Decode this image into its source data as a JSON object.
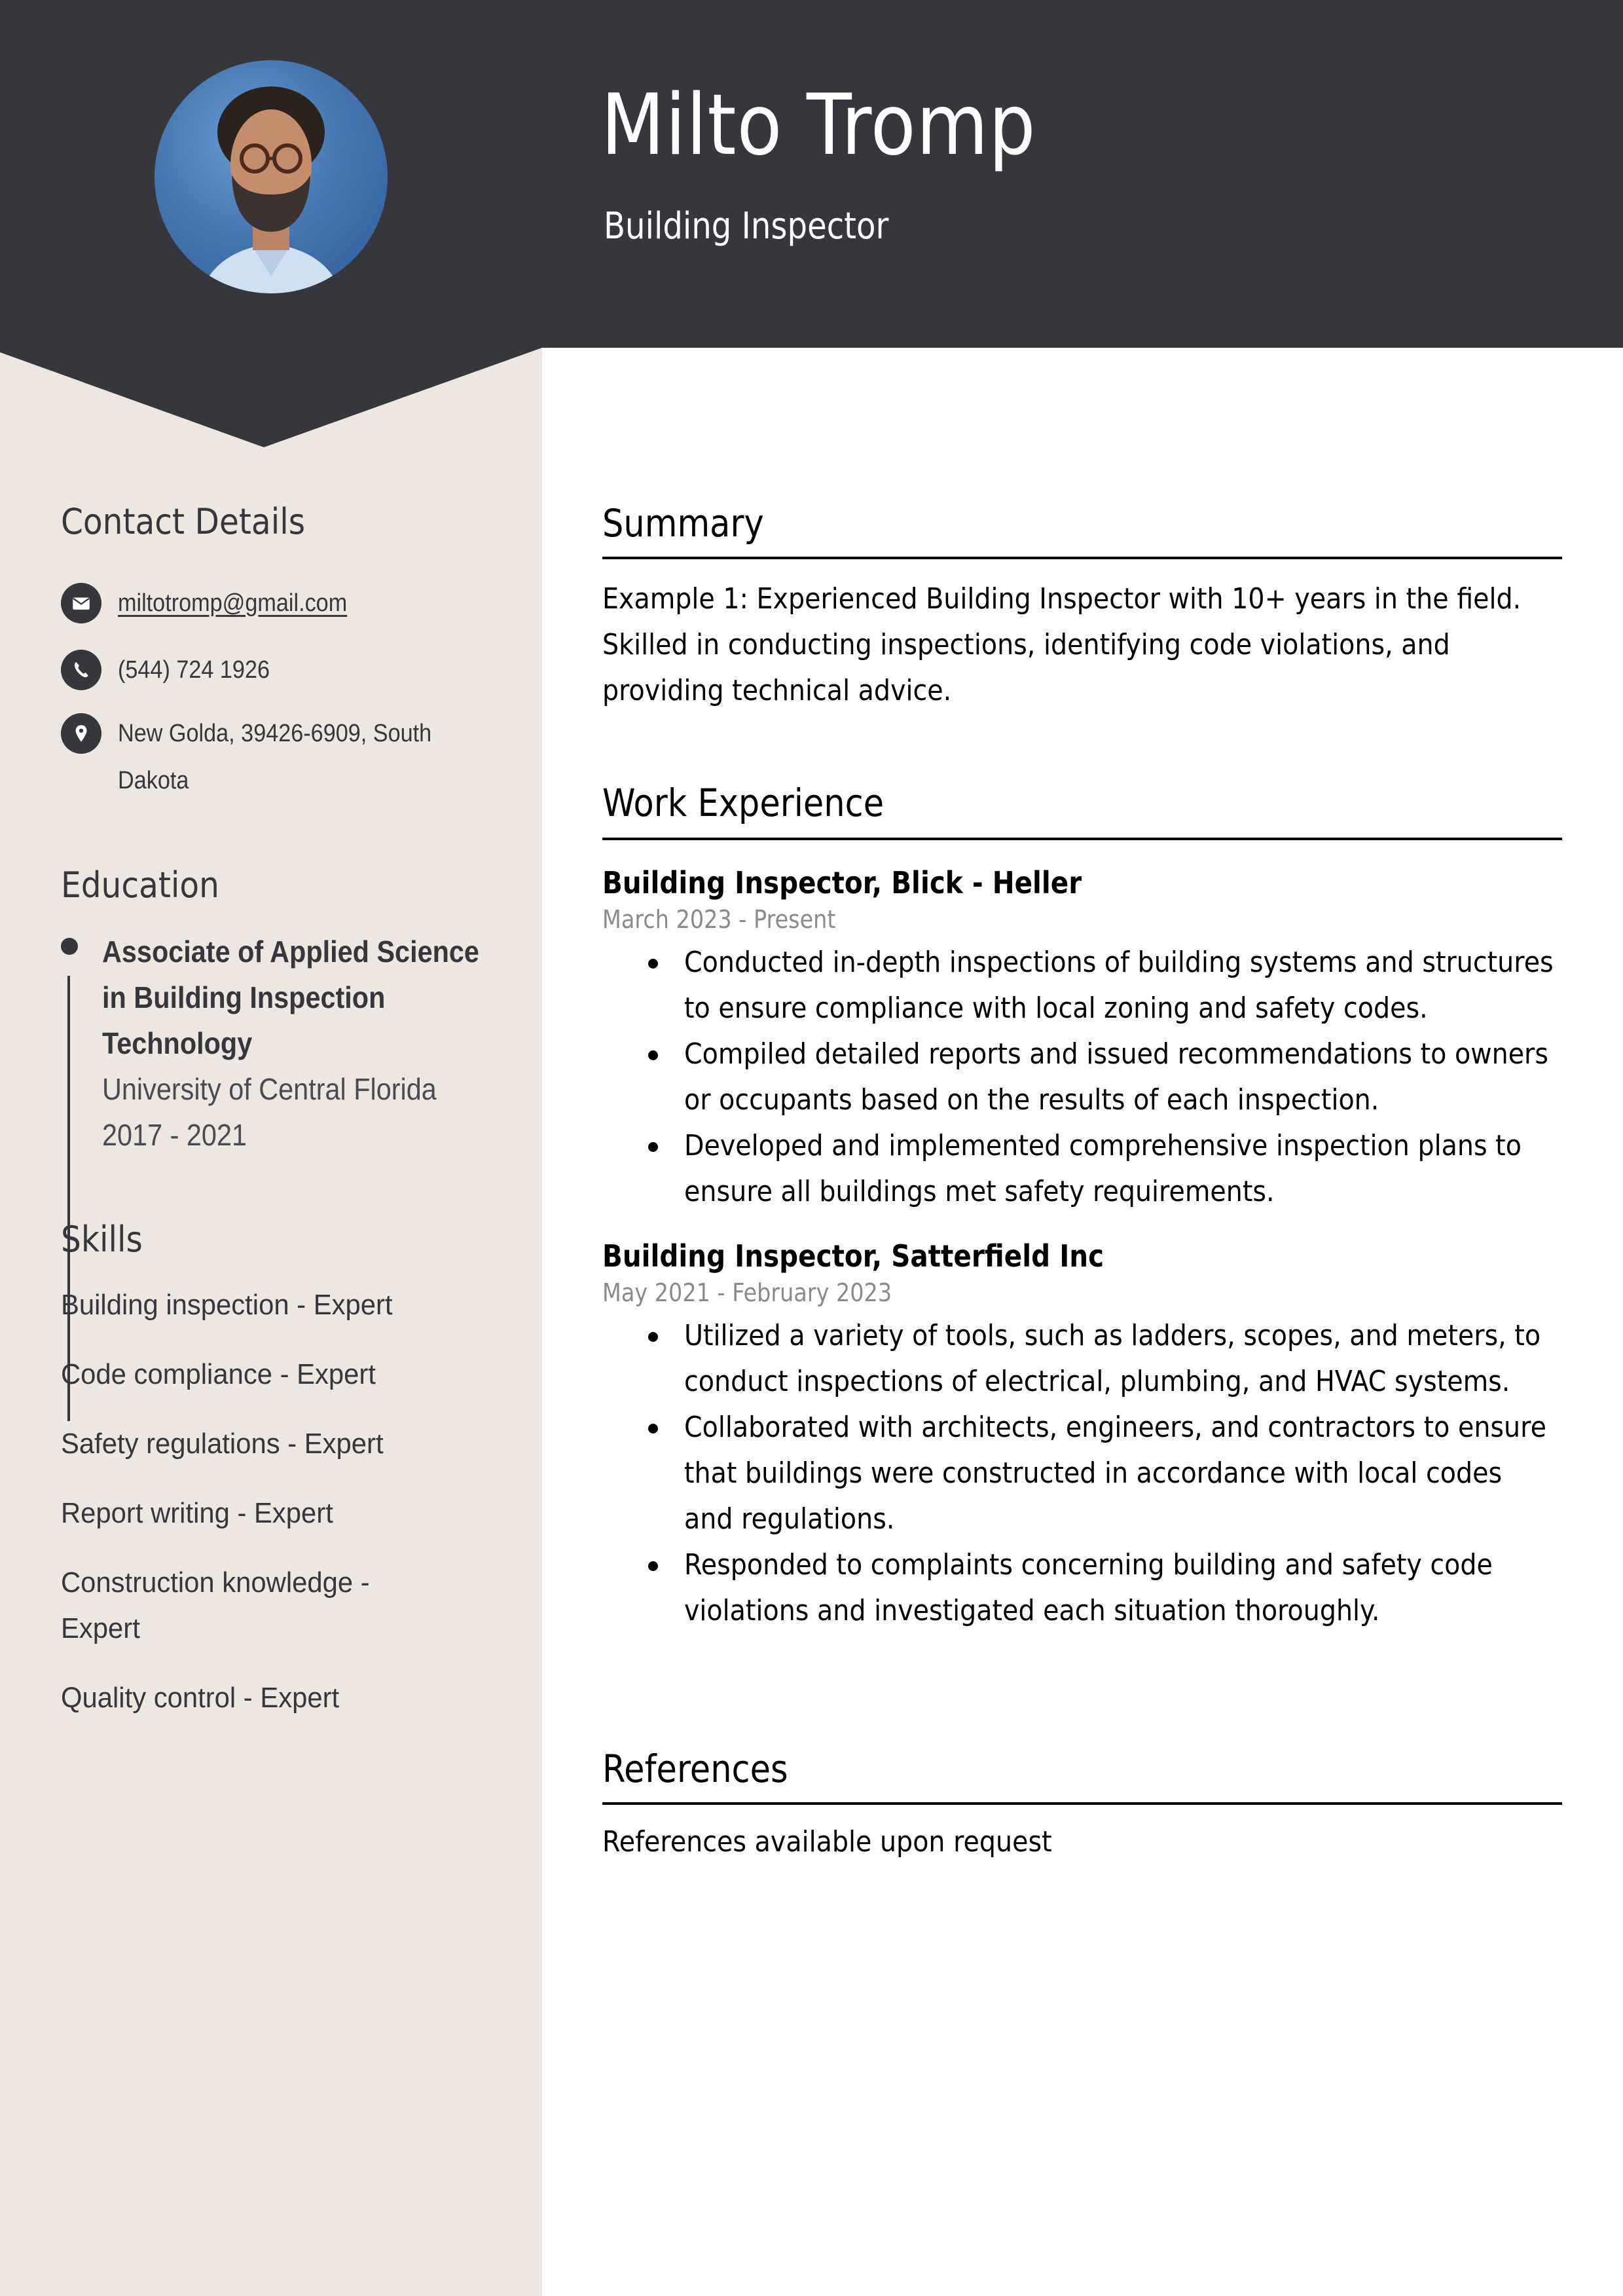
{
  "header": {
    "name": "Milto Tromp",
    "title": "Building Inspector",
    "photo_alt": "profile-photo"
  },
  "colors": {
    "header_bg": "#36373d",
    "sidebar_bg": "#eee6e1",
    "text_dark": "#36373d",
    "date_gray": "#8a8a8a"
  },
  "sidebar": {
    "contact": {
      "heading": "Contact Details",
      "items": [
        {
          "icon": "envelope-icon",
          "text": "miltotromp@gmail.com"
        },
        {
          "icon": "phone-icon",
          "text": "(544) 724 1926"
        },
        {
          "icon": "map-pin-icon",
          "text": "New Golda, 39426-6909, South Dakota"
        }
      ]
    },
    "education": {
      "heading": "Education",
      "items": [
        {
          "degree": "Associate of Applied Science in Building Inspection Technology",
          "school": "University of Central Florida",
          "years": "2017 - 2021"
        }
      ]
    },
    "skills": {
      "heading": "Skills",
      "items": [
        "Building inspection - Expert",
        "Code compliance - Expert",
        "Safety regulations - Expert",
        "Report writing - Expert",
        "Construction knowledge - Expert",
        "Quality control - Expert"
      ]
    }
  },
  "main": {
    "summary": {
      "heading": "Summary",
      "text": "Example 1: Experienced Building Inspector with 10+ years in the field. Skilled in conducting inspections, identifying code violations, and providing technical advice."
    },
    "experience": {
      "heading": "Work Experience",
      "jobs": [
        {
          "title": "Building Inspector, Blick - Heller",
          "dates": "March 2023 - Present",
          "bullets": [
            "Conducted in-depth inspections of building systems and structures to ensure compliance with local zoning and safety codes.",
            "Compiled detailed reports and issued recommendations to owners or occupants based on the results of each inspection.",
            "Developed and implemented comprehensive inspection plans to ensure all buildings met safety requirements."
          ]
        },
        {
          "title": "Building Inspector, Satterfield Inc",
          "dates": "May 2021 - February 2023",
          "bullets": [
            "Utilized a variety of tools, such as ladders, scopes, and meters, to conduct inspections of electrical, plumbing, and HVAC systems.",
            "Collaborated with architects, engineers, and contractors to ensure that buildings were constructed in accordance with local codes and regulations.",
            "Responded to complaints concerning building and safety code violations and investigated each situation thoroughly."
          ]
        }
      ]
    },
    "references": {
      "heading": "References",
      "text": "References available upon request"
    }
  }
}
